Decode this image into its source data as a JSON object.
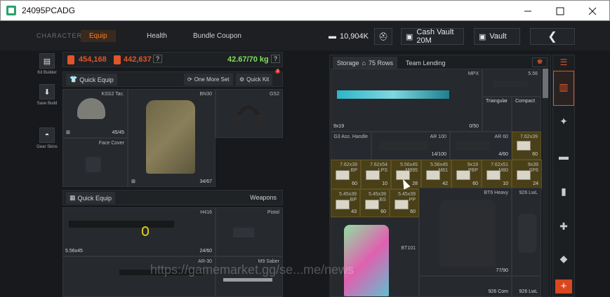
{
  "window": {
    "title": "24095PCADG"
  },
  "nav": {
    "character": "CHARACTER",
    "equip": "Equip",
    "health": "Health",
    "bundle": "Bundle Coupon"
  },
  "header": {
    "coins": "10,904K",
    "cash_vault": "Cash Vault 20M",
    "vault": "Vault"
  },
  "left_tools": [
    {
      "label": "Kit Builder"
    },
    {
      "label": "Save Build"
    },
    {
      "label": "Gear Skins"
    }
  ],
  "stats": {
    "value_a": "454,168",
    "value_b": "442,637",
    "weight": "42.67/70 kg",
    "help": "?"
  },
  "equip_toolbar": {
    "quick_equip": "Quick Equip",
    "one_more_set": "One More Set",
    "quick_kit": "Quick Kit",
    "quick_kit_badge": "2"
  },
  "gear": {
    "helmet": {
      "name": "KSS2 Tac.",
      "durability": "45/45"
    },
    "armor": {
      "name": "BN30",
      "durability": "34/67"
    },
    "headset": {
      "name": "GS2"
    },
    "face_cover": {
      "name": "Face Cover"
    }
  },
  "weapons_bar": {
    "quick_equip": "Quick Equip",
    "label": "Weapons"
  },
  "weapons": {
    "primary": {
      "name": "H416",
      "caliber": "5.56x45",
      "ammo": "24/60"
    },
    "pistol": {
      "name": "Pistol"
    },
    "secondary": {
      "name": "AR-30"
    },
    "melee": {
      "name": "M9 Saber"
    }
  },
  "storage": {
    "tab": "Storage",
    "rows": "75 Rows",
    "lending": "Team Lending"
  },
  "items": {
    "mpx": {
      "name": "MPX",
      "caliber": "9x19",
      "count": "0/50"
    },
    "suppressor": {
      "name": "5.56"
    },
    "triangular": {
      "name": "Triangular"
    },
    "compact": {
      "name": "Compact"
    },
    "handle": {
      "name": "G3 Ass. Handle"
    },
    "ar100": {
      "name": "AR 100",
      "count": "14/100"
    },
    "ar60": {
      "name": "AR 60",
      "count": "4/60"
    },
    "ammo_top": {
      "name": "7.62x39",
      "count": "60"
    },
    "bt6": {
      "name": "BT6 Heavy",
      "count": "77/90"
    },
    "lwl": {
      "name": "926 LwL"
    },
    "bt101": {
      "name": "BT101"
    },
    "bt_bottom1": {
      "name": "926 Com"
    },
    "bt_bottom2": {
      "name": "926 LwL"
    }
  },
  "ammo_row1": [
    {
      "cal": "7.62x39",
      "type": "BP",
      "count": "60"
    },
    {
      "cal": "7.62x54",
      "type": "LPS",
      "count": "10"
    },
    {
      "cal": "5.56x45",
      "type": "M995",
      "count": "28"
    },
    {
      "cal": "5.56x45",
      "type": "M61",
      "count": "42"
    },
    {
      "cal": "9x19",
      "type": "PBP",
      "count": "60"
    },
    {
      "cal": "7.62x51",
      "type": "M80",
      "count": "10"
    },
    {
      "cal": "9x39",
      "type": "SP6",
      "count": "24"
    }
  ],
  "ammo_row2": [
    {
      "cal": "5.45x39",
      "type": "BP",
      "count": "43"
    },
    {
      "cal": "5.45x39",
      "type": "BS",
      "count": "60"
    },
    {
      "cal": "5.45x39",
      "type": "PP",
      "count": "60"
    }
  ],
  "watermark": "https://gamemarket.gg/se...me/news",
  "colors": {
    "accent": "#ff7a22",
    "weight": "#7fe05a",
    "value_red": "#e0552a",
    "gold_slot": "#4a4018"
  }
}
